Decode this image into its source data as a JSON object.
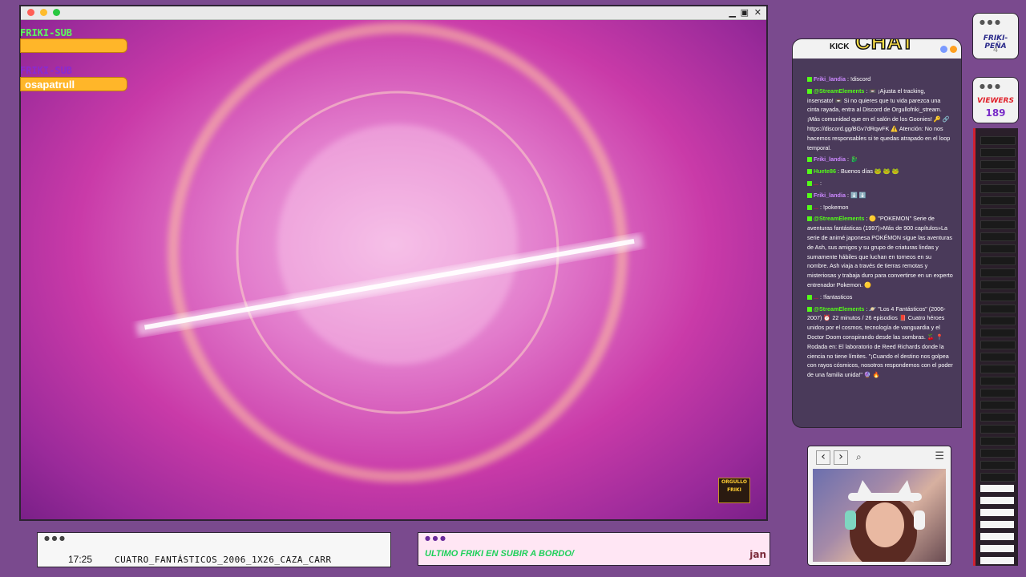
{
  "sub_panel": {
    "title": "FRIKI-SUB",
    "title2": "FRIKI-SUB",
    "latest_sub": "osapatrull"
  },
  "chat": {
    "header_brand": "KICK",
    "header_title": "CHAT",
    "messages": [
      {
        "user": "Friki_landia",
        "text": ": !discord",
        "color": "#cc88ff"
      },
      {
        "user": "@StreamElements",
        "text": ": 📼 ¡Ajusta el tracking, insensato! 📼 Si no quieres que tu vida parezca una cinta rayada, entra al Discord de Orgullofriki_stream. ¡Más comunidad que en el salón de los Goonies! 🔑 🔗 https://discord.gg/BGv7dRqwFK ⚠️ Atención: No nos hacemos responsables si te quedas atrapado en el loop temporal.",
        "color": "#53fc18"
      },
      {
        "user": "Friki_landia",
        "text": ": 🐉",
        "color": "#cc88ff"
      },
      {
        "user": "Huete86",
        "text": ": Buenos días 🐸 🐸 🐸",
        "color": "#53fc18"
      },
      {
        "user": "...",
        "text": ":",
        "color": "#d0203a"
      },
      {
        "user": "Friki_landia",
        "text": ": ⬇️ ⬇️",
        "color": "#cc88ff"
      },
      {
        "user": "...",
        "text": ": !pokemon",
        "color": "#d0203a"
      },
      {
        "user": "@StreamElements",
        "text": ": 🟡 \"POKEMON\" Serie de aventuras fantásticas (1997)»Más de 900 capítulos»La serie de animé japonesa POKÉMON sigue las aventuras de Ash, sus amigos y su grupo de criaturas lindas y sumamente hábiles que luchan en torneos en su nombre. Ash viaja a través de tierras remotas y misteriosas y trabaja duro para convertirse en un experto entrenador Pokemon. 🟡",
        "color": "#53fc18"
      },
      {
        "user": "...",
        "text": ": !fantasticos",
        "color": "#d0203a"
      },
      {
        "user": "@StreamElements",
        "text": ": 🪐 \"Los 4 Fantásticos\" (2006-2007) ⏰ 22 minutos / 26 episodios 📕 Cuatro héroes unidos por el cosmos, tecnología de vanguardia y el Doctor Doom conspirando desde las sombras. 🍒 📍 Rodada en: El laboratorio de Reed Richards donde la ciencia no tiene límites. \"¡Cuando el destino nos golpea con rayos cósmicos, nosotros respondemos con el poder de una familia unida!\" 🔮 🔥",
        "color": "#53fc18"
      }
    ]
  },
  "friki_pena": {
    "label": "FRIKI-PEÑA",
    "value": "4"
  },
  "viewers": {
    "label": "VIEWERS",
    "value": "189"
  },
  "now_playing": {
    "time": "17:25",
    "file": "CUATRO_FANTÁSTICOS_2006_1X26_CAZA_CARR"
  },
  "last_sub": {
    "label": "ULTIMO FRIKI EN SUBIR A BORDO/",
    "name": "jan"
  },
  "logo_text": "ORGULLO FRIKI",
  "colors": {
    "bg": "#7a4a8e",
    "accent_green": "#53fc18",
    "accent_orange": "#ffb629",
    "viewers_purple": "#7a2dc8"
  }
}
